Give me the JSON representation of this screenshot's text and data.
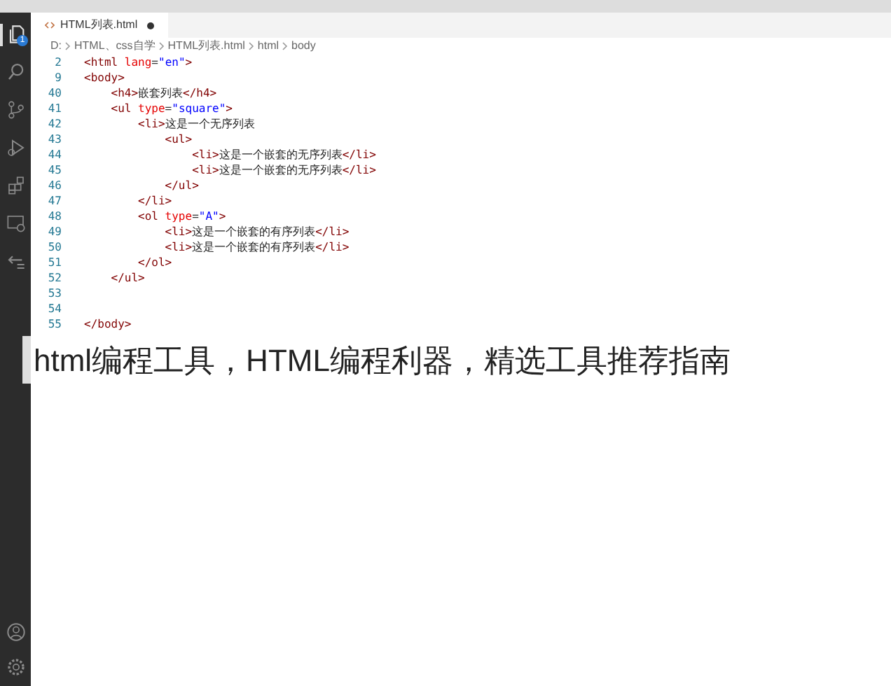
{
  "activity_bar": {
    "items": [
      {
        "kind": "files",
        "selected": true,
        "badge": "1"
      },
      {
        "kind": "search",
        "selected": false
      },
      {
        "kind": "source-control",
        "selected": false
      },
      {
        "kind": "run",
        "selected": false
      },
      {
        "kind": "extensions",
        "selected": false
      },
      {
        "kind": "remote",
        "selected": false
      },
      {
        "kind": "testing",
        "selected": false
      }
    ],
    "bottom": [
      {
        "kind": "account"
      },
      {
        "kind": "settings"
      }
    ]
  },
  "tabs": [
    {
      "label": "HTML列表.html",
      "selected": true,
      "modified": true
    }
  ],
  "breadcrumb": [
    "D:",
    "HTML、css自学",
    "HTML列表.html",
    "html",
    "body"
  ],
  "code": [
    {
      "number": "2",
      "tokens": [
        {
          "kind": "tag",
          "text": "<html "
        },
        {
          "kind": "attr",
          "text": "lang"
        },
        {
          "kind": "punct",
          "text": "="
        },
        {
          "kind": "value",
          "text": "\"en\""
        },
        {
          "kind": "tag",
          "text": ">"
        }
      ]
    },
    {
      "number": "9",
      "tokens": [
        {
          "kind": "tag",
          "text": "<body>"
        }
      ]
    },
    {
      "number": "40",
      "tokens": [
        {
          "kind": "tag",
          "text": "    <h4>"
        },
        {
          "kind": "text",
          "text": "嵌套列表"
        },
        {
          "kind": "tag",
          "text": "</h4>"
        }
      ]
    },
    {
      "number": "41",
      "tokens": [
        {
          "kind": "tag",
          "text": "    <ul "
        },
        {
          "kind": "attr",
          "text": "type"
        },
        {
          "kind": "punct",
          "text": "="
        },
        {
          "kind": "value",
          "text": "\"square\""
        },
        {
          "kind": "tag",
          "text": ">"
        }
      ]
    },
    {
      "number": "42",
      "tokens": [
        {
          "kind": "tag",
          "text": "        <li>"
        },
        {
          "kind": "text",
          "text": "这是一个无序列表"
        }
      ]
    },
    {
      "number": "43",
      "tokens": [
        {
          "kind": "tag",
          "text": "            <ul>"
        }
      ]
    },
    {
      "number": "44",
      "tokens": [
        {
          "kind": "tag",
          "text": "                <li>"
        },
        {
          "kind": "text",
          "text": "这是一个嵌套的无序列表"
        },
        {
          "kind": "tag",
          "text": "</li>"
        }
      ]
    },
    {
      "number": "45",
      "tokens": [
        {
          "kind": "tag",
          "text": "                <li>"
        },
        {
          "kind": "text",
          "text": "这是一个嵌套的无序列表"
        },
        {
          "kind": "tag",
          "text": "</li>"
        }
      ]
    },
    {
      "number": "46",
      "tokens": [
        {
          "kind": "tag",
          "text": "            </ul>"
        }
      ]
    },
    {
      "number": "47",
      "tokens": [
        {
          "kind": "tag",
          "text": "        </li>"
        }
      ]
    },
    {
      "number": "48",
      "tokens": [
        {
          "kind": "tag",
          "text": "        <ol "
        },
        {
          "kind": "attr",
          "text": "type"
        },
        {
          "kind": "punct",
          "text": "="
        },
        {
          "kind": "value",
          "text": "\"A\""
        },
        {
          "kind": "tag",
          "text": ">"
        }
      ]
    },
    {
      "number": "49",
      "tokens": [
        {
          "kind": "tag",
          "text": "            <li>"
        },
        {
          "kind": "text",
          "text": "这是一个嵌套的有序列表"
        },
        {
          "kind": "tag",
          "text": "</li>"
        }
      ]
    },
    {
      "number": "50",
      "tokens": [
        {
          "kind": "tag",
          "text": "            <li>"
        },
        {
          "kind": "text",
          "text": "这是一个嵌套的有序列表"
        },
        {
          "kind": "tag",
          "text": "</li>"
        }
      ]
    },
    {
      "number": "51",
      "tokens": [
        {
          "kind": "tag",
          "text": "        </ol>"
        }
      ]
    },
    {
      "number": "52",
      "tokens": [
        {
          "kind": "tag",
          "text": "    </ul>"
        }
      ]
    },
    {
      "number": "53"
    },
    {
      "number": "54"
    },
    {
      "number": "55",
      "tokens": [
        {
          "kind": "tag",
          "text": "</body>"
        }
      ]
    }
  ],
  "caption": "html编程工具，HTML编程利器，精选工具推荐指南"
}
